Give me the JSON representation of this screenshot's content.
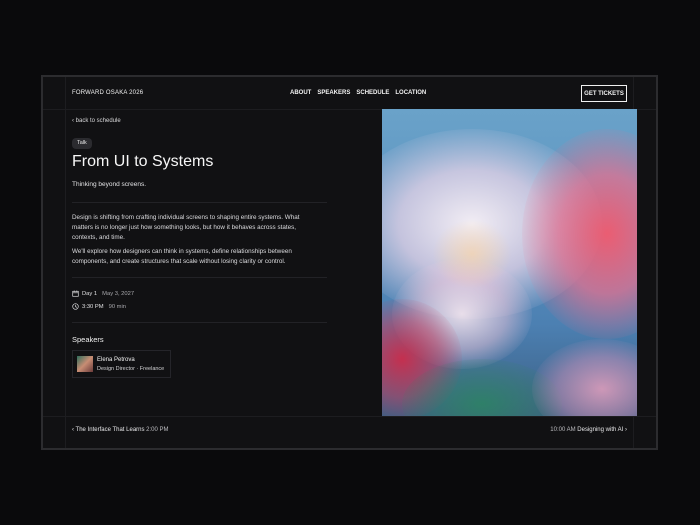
{
  "header": {
    "brand": "FORWARD OSAKA 2026",
    "nav": [
      {
        "label": "ABOUT"
      },
      {
        "label": "SPEAKERS"
      },
      {
        "label": "SCHEDULE"
      },
      {
        "label": "LOCATION"
      }
    ],
    "cta_label": "GET TICKETS"
  },
  "talk": {
    "back_label": "‹ back to schedule",
    "tag": "Talk",
    "title": "From UI to Systems",
    "subtitle": "Thinking beyond screens.",
    "paragraphs": [
      "Design is shifting from crafting individual screens to shaping entire systems. What matters is no longer just how something looks, but how it behaves across states, contexts, and time.",
      "We'll explore how designers can think in systems, define relationships between components, and create structures that scale without losing clarity or control."
    ],
    "day": "Day 1",
    "date": "May 3, 2027",
    "time": "3:30 PM",
    "duration": "90 min",
    "speakers_heading": "Speakers",
    "speaker": {
      "name": "Elena Petrova",
      "role": "Design Director · Freelance"
    }
  },
  "image": {
    "icon": "abstract-flower-photo",
    "colors": [
      "#5d95c1",
      "#f4ecf2",
      "#ef4f6e",
      "#e6a0b4",
      "#c4456e",
      "#3c8f5f"
    ]
  },
  "footer": {
    "prev_title": "‹ The Interface That Learns",
    "prev_time": "2:00 PM",
    "next_time": "10:00 AM",
    "next_title": "Designing with AI ›"
  },
  "icons": {
    "calendar": "calendar-icon",
    "clock": "clock-icon"
  }
}
